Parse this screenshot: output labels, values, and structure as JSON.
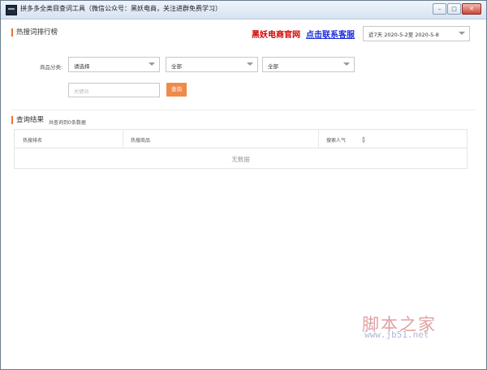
{
  "window": {
    "title": "拼多多全类目查词工具（微信公众号：黑妖电商，关注进群免费学习）",
    "buttons": {
      "minimize": "–",
      "maximize": "□",
      "close": "✕"
    }
  },
  "hot_search": {
    "section_title": "热搜词排行榜",
    "link_official": "黑妖电商官网",
    "link_service": "点击联系客服",
    "date_range": "近7天 2020-5-2至 2020-5-8",
    "category_label": "商品分类:",
    "category_1": "请选择",
    "category_2": "全部",
    "category_3": "全部",
    "keyword_placeholder": "关键词",
    "search_button": "查询"
  },
  "results": {
    "section_title": "查询结果",
    "summary": "共查询到0条数据",
    "columns": [
      "热搜排名",
      "热搜商品",
      "搜索人气"
    ],
    "empty_text": "无数据"
  },
  "watermark": {
    "site_name": "脚本之家",
    "site_url": "www.jb51.net"
  },
  "colors": {
    "accent": "#f08a4b",
    "link_red": "#d40000",
    "link_blue": "#1a2bd8"
  }
}
